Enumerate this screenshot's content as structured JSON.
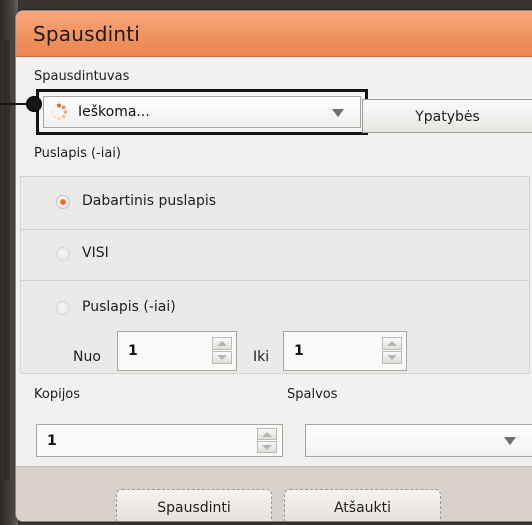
{
  "dialog": {
    "title": "Spausdinti"
  },
  "printer": {
    "label": "Spausdintuvas",
    "selected_value": "Ieškoma...",
    "properties_label": "Ypatybės"
  },
  "pages": {
    "label": "Puslapis (-iai)",
    "options": [
      {
        "label": "Dabartinis puslapis",
        "checked": true
      },
      {
        "label": "VISI",
        "checked": false
      },
      {
        "label": "Puslapis (-iai)",
        "checked": false
      }
    ],
    "from_label": "Nuo",
    "from_value": "1",
    "to_label": "Iki",
    "to_value": "1"
  },
  "copies": {
    "label": "Kopijos",
    "value": "1"
  },
  "color": {
    "label": "Spalvos",
    "selected_value": ""
  },
  "footer": {
    "print_label": "Spausdinti",
    "cancel_label": "Atšaukti"
  },
  "colors": {
    "title_bar": "#F0935F",
    "radio_checked": "#EF6F3C",
    "dialog_bg": "#F2F1EF",
    "footer_bg": "#D8D1CB"
  },
  "icons": {
    "spinner": "loading-spinner-icon",
    "dropdown": "chevron-down-icon",
    "stepper_up": "chevron-up-icon",
    "stepper_down": "chevron-down-icon"
  }
}
